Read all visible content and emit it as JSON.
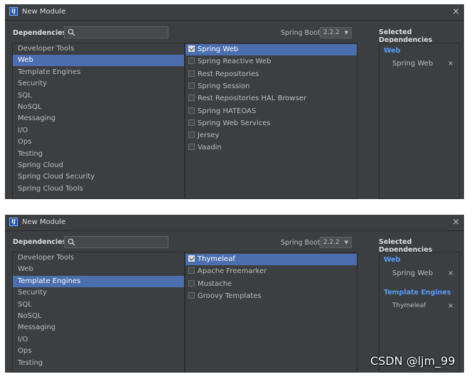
{
  "dialogs": [
    {
      "title": "New Module",
      "close_glyph": "×",
      "dependencies_label": "Dependencies",
      "spring_boot_label": "Spring Boot",
      "spring_boot_version": "2.2.2",
      "selected_dependencies_label": "Selected Dependencies",
      "categories": [
        {
          "label": "Developer Tools",
          "selected": false
        },
        {
          "label": "Web",
          "selected": true
        },
        {
          "label": "Template Engines",
          "selected": false
        },
        {
          "label": "Security",
          "selected": false
        },
        {
          "label": "SQL",
          "selected": false
        },
        {
          "label": "NoSQL",
          "selected": false
        },
        {
          "label": "Messaging",
          "selected": false
        },
        {
          "label": "I/O",
          "selected": false
        },
        {
          "label": "Ops",
          "selected": false
        },
        {
          "label": "Testing",
          "selected": false
        },
        {
          "label": "Spring Cloud",
          "selected": false
        },
        {
          "label": "Spring Cloud Security",
          "selected": false
        },
        {
          "label": "Spring Cloud Tools",
          "selected": false
        }
      ],
      "dependencies": [
        {
          "label": "Spring Web",
          "checked": true,
          "highlighted": true
        },
        {
          "label": "Spring Reactive Web",
          "checked": false,
          "highlighted": false
        },
        {
          "label": "Rest Repositories",
          "checked": false,
          "highlighted": false
        },
        {
          "label": "Spring Session",
          "checked": false,
          "highlighted": false
        },
        {
          "label": "Rest Repositories HAL Browser",
          "checked": false,
          "highlighted": false
        },
        {
          "label": "Spring HATEOAS",
          "checked": false,
          "highlighted": false
        },
        {
          "label": "Spring Web Services",
          "checked": false,
          "highlighted": false
        },
        {
          "label": "Jersey",
          "checked": false,
          "highlighted": false
        },
        {
          "label": "Vaadin",
          "checked": false,
          "highlighted": false
        }
      ],
      "selected_groups": [
        {
          "group": "Web",
          "items": [
            "Spring Web"
          ]
        }
      ],
      "remove_glyph": "×"
    },
    {
      "title": "New Module",
      "close_glyph": "×",
      "dependencies_label": "Dependencies",
      "spring_boot_label": "Spring Boot",
      "spring_boot_version": "2.2.2",
      "selected_dependencies_label": "Selected Dependencies",
      "categories": [
        {
          "label": "Developer Tools",
          "selected": false
        },
        {
          "label": "Web",
          "selected": false
        },
        {
          "label": "Template Engines",
          "selected": true
        },
        {
          "label": "Security",
          "selected": false
        },
        {
          "label": "SQL",
          "selected": false
        },
        {
          "label": "NoSQL",
          "selected": false
        },
        {
          "label": "Messaging",
          "selected": false
        },
        {
          "label": "I/O",
          "selected": false
        },
        {
          "label": "Ops",
          "selected": false
        },
        {
          "label": "Testing",
          "selected": false
        }
      ],
      "dependencies": [
        {
          "label": "Thymeleaf",
          "checked": true,
          "highlighted": true
        },
        {
          "label": "Apache Freemarker",
          "checked": false,
          "highlighted": false
        },
        {
          "label": "Mustache",
          "checked": false,
          "highlighted": false
        },
        {
          "label": "Groovy Templates",
          "checked": false,
          "highlighted": false
        }
      ],
      "selected_groups": [
        {
          "group": "Web",
          "items": [
            "Spring Web"
          ]
        },
        {
          "group": "Template Engines",
          "items": [
            "Thymeleaf"
          ]
        }
      ],
      "remove_glyph": "×"
    }
  ],
  "watermark": "CSDN @ljm_99",
  "colors": {
    "dialog_bg": "#3c3f41",
    "selection": "#4b6eaf",
    "group_title": "#589df6",
    "text": "#bbbbbb"
  },
  "icons": {
    "app": "intellij-app-icon",
    "search": "search-icon",
    "close": "close-icon",
    "dropdown": "dropdown-arrow-icon",
    "checkbox": "checkbox-icon",
    "remove": "remove-icon"
  }
}
